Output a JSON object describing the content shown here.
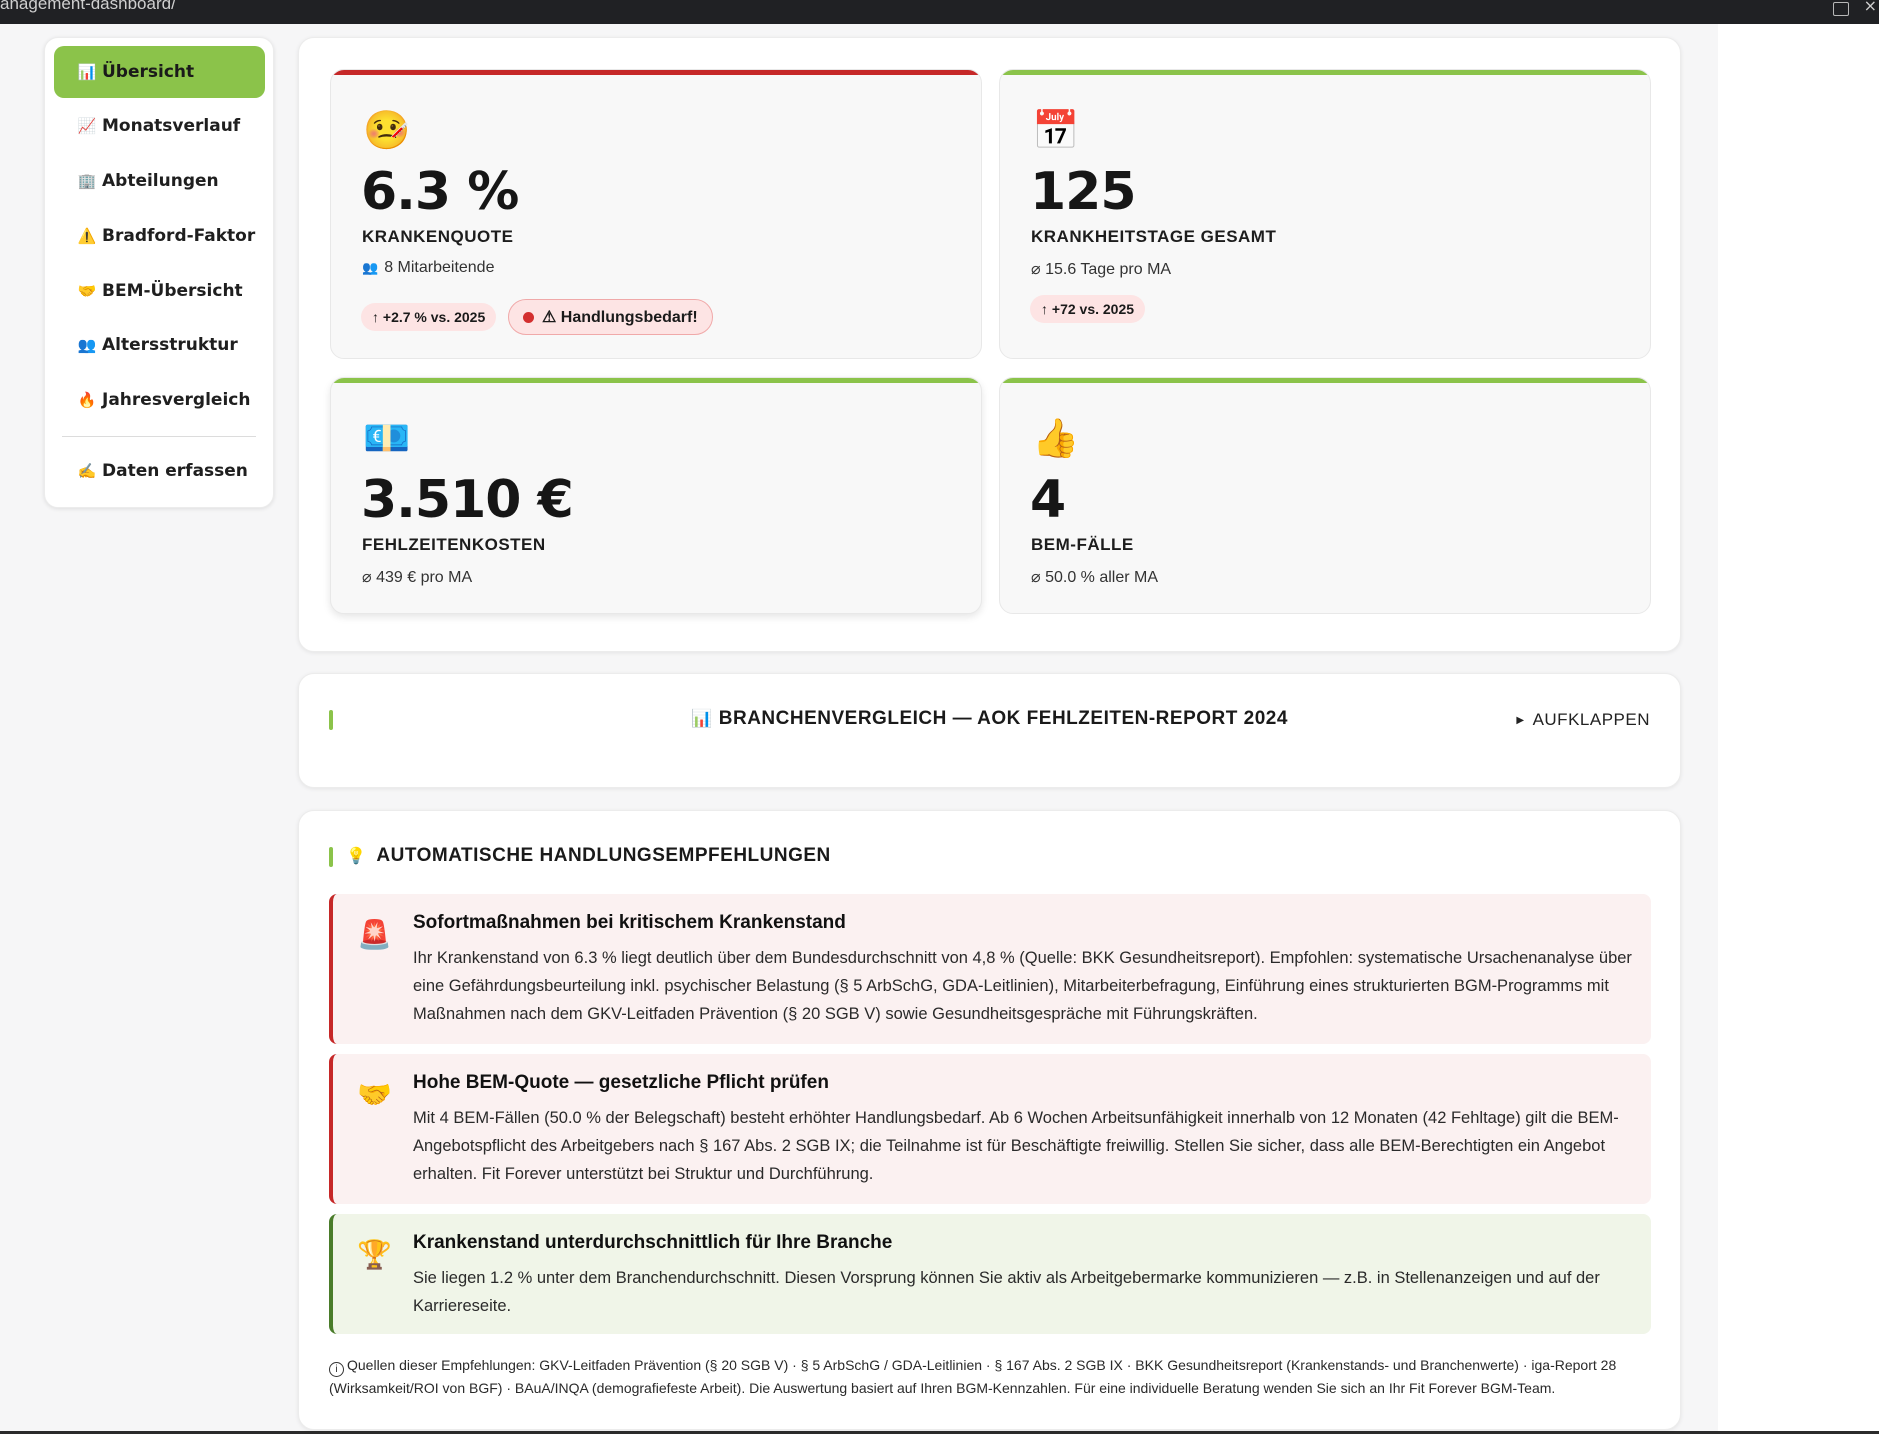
{
  "browser": {
    "url_fragment": "anagement-dashboard/"
  },
  "sidebar": {
    "items": [
      {
        "icon": "📊",
        "icon_name": "bar-chart-icon",
        "label": "Übersicht",
        "active": true
      },
      {
        "icon": "📈",
        "icon_name": "trend-chart-icon",
        "label": "Monatsverlauf"
      },
      {
        "icon": "🏢",
        "icon_name": "building-icon",
        "label": "Abteilungen"
      },
      {
        "icon": "⚠️",
        "icon_name": "warning-icon",
        "label": "Bradford-Faktor"
      },
      {
        "icon": "🤝",
        "icon_name": "handshake-icon",
        "label": "BEM-Übersicht"
      },
      {
        "icon": "👥",
        "icon_name": "people-icon",
        "label": "Altersstruktur"
      },
      {
        "icon": "🔥",
        "icon_name": "fire-icon",
        "label": "Jahresvergleich"
      },
      {
        "icon": "✍️",
        "icon_name": "writing-hand-icon",
        "label": "Daten erfassen"
      }
    ]
  },
  "kpis": {
    "krankenquote": {
      "icon": "🤒",
      "icon_name": "sick-face-icon",
      "value": "6.3 %",
      "label": "KRANKENQUOTE",
      "sub_icon": "👥",
      "sub": "8 Mitarbeitende",
      "badge": "↑ +2.7 % vs. 2025",
      "alert": "⚠ Handlungsbedarf!",
      "stripe_color": "#c62828"
    },
    "krankheitstage": {
      "icon": "📅",
      "icon_name": "calendar-icon",
      "value": "125",
      "label": "KRANKHEITSTAGE GESAMT",
      "sub": "⌀ 15.6 Tage pro MA",
      "badge": "↑ +72 vs. 2025",
      "stripe_color": "#8bc34a"
    },
    "kosten": {
      "icon": "💶",
      "icon_name": "euro-banknote-icon",
      "value": "3.510 €",
      "label": "FEHLZEITENKOSTEN",
      "sub": "⌀ 439 € pro MA",
      "stripe_color": "#8bc34a"
    },
    "bem": {
      "icon": "👍",
      "icon_name": "thumbs-up-icon",
      "value": "4",
      "label": "BEM-FÄLLE",
      "sub": "⌀ 50.0 % aller MA",
      "stripe_color": "#8bc34a"
    }
  },
  "branchenvergleich": {
    "icon": "📊",
    "title": "BRANCHENVERGLEICH — AOK FEHLZEITEN-REPORT 2024",
    "toggle": "AUFKLAPPEN"
  },
  "recommendations": {
    "icon": "💡",
    "heading": "AUTOMATISCHE HANDLUNGSEMPFEHLUNGEN",
    "items": [
      {
        "icon": "🚨",
        "icon_name": "siren-icon",
        "tone": "red",
        "title": "Sofortmaßnahmen bei kritischem Krankenstand",
        "text": "Ihr Krankenstand von 6.3 % liegt deutlich über dem Bundesdurchschnitt von 4,8 % (Quelle: BKK Gesundheitsreport). Empfohlen: systematische Ursachenanalyse über eine Gefährdungsbeurteilung inkl. psychischer Belastung (§ 5 ArbSchG, GDA-Leitlinien), Mitarbeiterbefragung, Einführung eines strukturierten BGM-Programms mit Maßnahmen nach dem GKV-Leitfaden Prävention (§ 20 SGB V) sowie Gesundheitsgespräche mit Führungskräften."
      },
      {
        "icon": "🤝",
        "icon_name": "handshake-icon",
        "tone": "red",
        "title": "Hohe BEM-Quote — gesetzliche Pflicht prüfen",
        "text": "Mit 4 BEM-Fällen (50.0 % der Belegschaft) besteht erhöhter Handlungsbedarf. Ab 6 Wochen Arbeitsunfähigkeit innerhalb von 12 Monaten (42 Fehltage) gilt die BEM-Angebotspflicht des Arbeitgebers nach § 167 Abs. 2 SGB IX; die Teilnahme ist für Beschäftigte freiwillig. Stellen Sie sicher, dass alle BEM-Berechtigten ein Angebot erhalten. Fit Forever unterstützt bei Struktur und Durchführung."
      },
      {
        "icon": "🏆",
        "icon_name": "trophy-icon",
        "tone": "green",
        "title": "Krankenstand unterdurchschnittlich für Ihre Branche",
        "text": "Sie liegen 1.2 % unter dem Branchendurchschnitt. Diesen Vorsprung können Sie aktiv als Arbeitgebermarke kommunizieren — z.B. in Stellenanzeigen und auf der Karriereseite."
      }
    ],
    "sources": "Quellen dieser Empfehlungen: GKV-Leitfaden Prävention (§ 20 SGB V) · § 5 ArbSchG / GDA-Leitlinien · § 167 Abs. 2 SGB IX · BKK Gesundheitsreport (Krankenstands- und Branchenwerte) · iga-Report 28 (Wirksamkeit/ROI von BGF) · BAuA/INQA (demografiefeste Arbeit). Die Auswertung basiert auf Ihren BGM-Kennzahlen. Für eine individuelle Beratung wenden Sie sich an Ihr Fit Forever BGM-Team."
  },
  "colors": {
    "accent": "#8bc34a",
    "danger": "#c62828",
    "success": "#4a7c2a"
  }
}
